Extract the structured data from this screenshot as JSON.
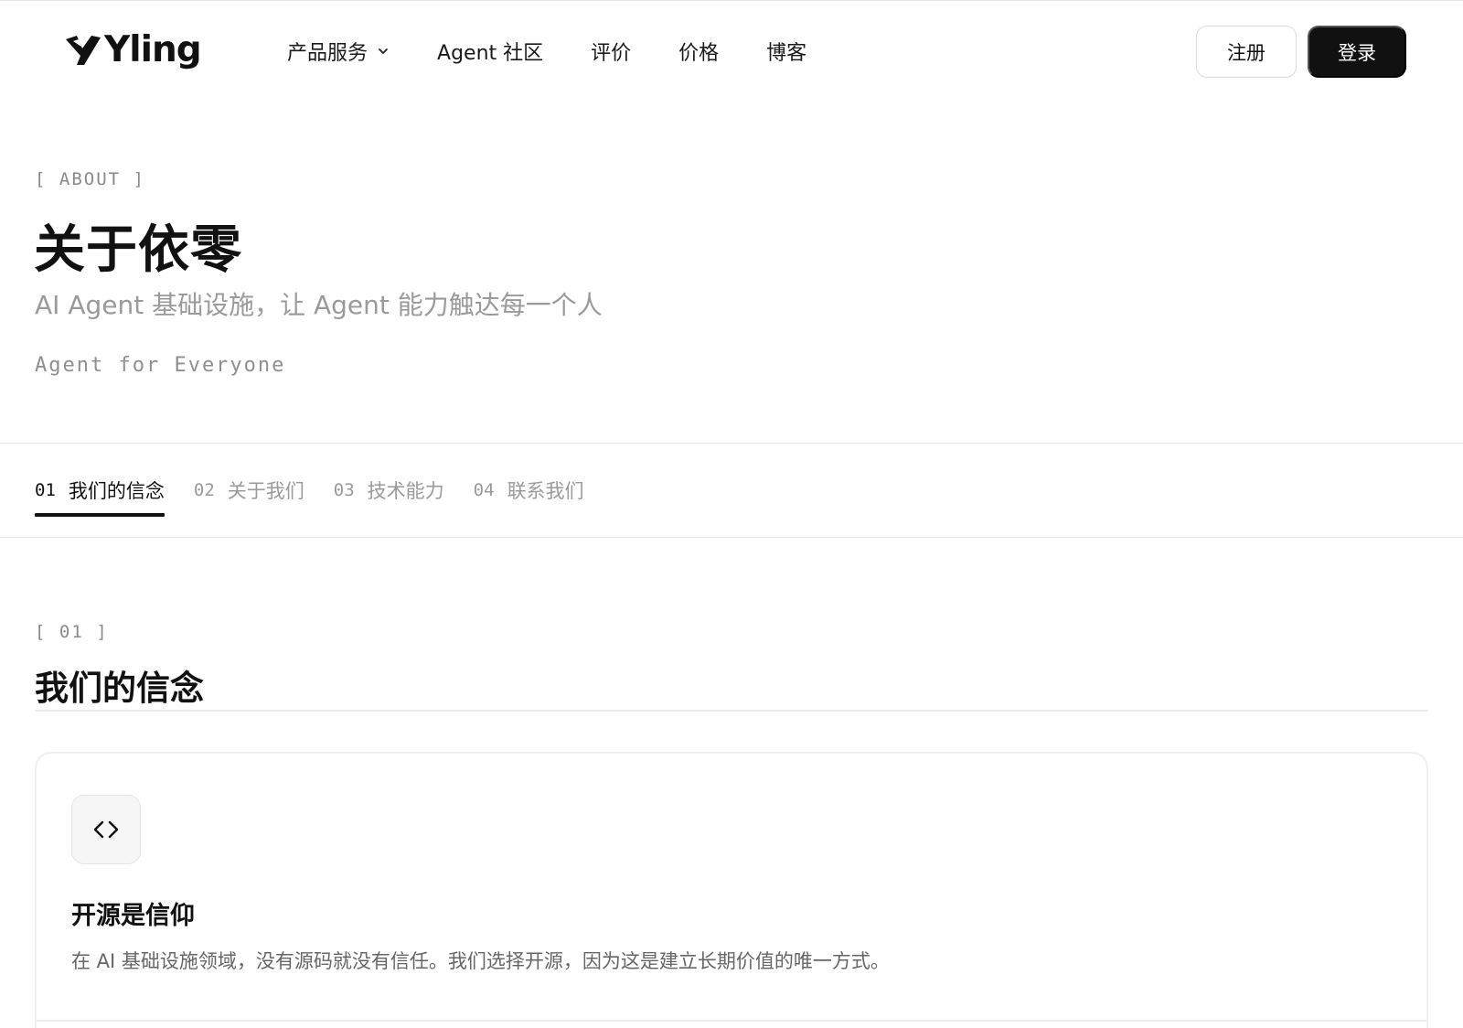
{
  "brand": {
    "name": "Yling"
  },
  "nav": {
    "items": [
      {
        "label": "产品服务",
        "has_dropdown": true
      },
      {
        "label": "Agent 社区"
      },
      {
        "label": "评价"
      },
      {
        "label": "价格"
      },
      {
        "label": "博客"
      }
    ]
  },
  "auth": {
    "register_label": "注册",
    "login_label": "登录"
  },
  "hero": {
    "tag": "[ ABOUT ]",
    "title": "关于依零",
    "subtitle": "AI Agent 基础设施，让 Agent 能力触达每一个人",
    "mono_line": "Agent for Everyone"
  },
  "tabs": [
    {
      "num": "01",
      "label": "我们的信念",
      "active": true
    },
    {
      "num": "02",
      "label": "关于我们",
      "active": false
    },
    {
      "num": "03",
      "label": "技术能力",
      "active": false
    },
    {
      "num": "04",
      "label": "联系我们",
      "active": false
    }
  ],
  "section": {
    "tag": "[ 01 ]",
    "title": "我们的信念",
    "card": {
      "icon": "code-brackets-icon",
      "title": "开源是信仰",
      "description": "在 AI 基础设施领域，没有源码就没有信任。我们选择开源，因为这是建立长期价值的唯一方式。"
    }
  },
  "colors": {
    "primary": "#111111",
    "muted_text": "#9a9a9a",
    "border": "#e6e6e6",
    "icon_bg": "#f6f6f6"
  }
}
